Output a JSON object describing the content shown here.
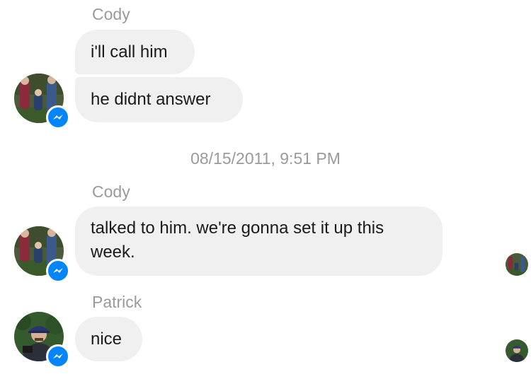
{
  "thread": {
    "groups": [
      {
        "sender": "Cody",
        "messages": [
          "i'll call him",
          "he didnt answer"
        ]
      },
      {
        "timestamp": "08/15/2011, 9:51 PM",
        "sender": "Cody",
        "messages": [
          "talked to him. we're gonna set it up this week."
        ]
      },
      {
        "sender": "Patrick",
        "messages": [
          "nice"
        ]
      }
    ]
  },
  "icons": {
    "badge": "messenger-badge-icon",
    "avatar_cody": "family-photo-avatar",
    "avatar_patrick": "man-with-cap-avatar"
  },
  "colors": {
    "bubble_background": "#f0f0f0",
    "secondary_text": "#9a9a9a",
    "messenger_blue": "#0084ff"
  }
}
